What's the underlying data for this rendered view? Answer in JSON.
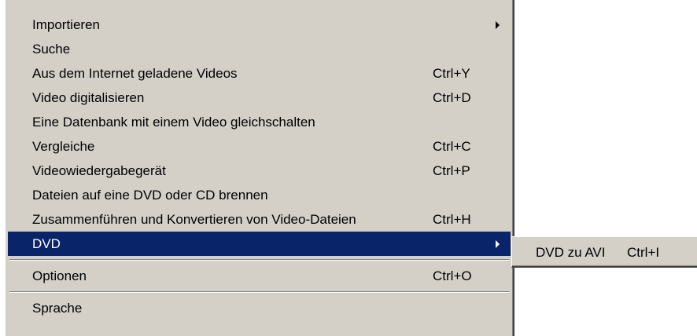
{
  "menu": {
    "items": [
      {
        "label": "Importieren",
        "shortcut": ""
      },
      {
        "label": "Suche",
        "shortcut": ""
      },
      {
        "label": "Aus dem Internet geladene Videos",
        "shortcut": "Ctrl+Y"
      },
      {
        "label": "Video digitalisieren",
        "shortcut": "Ctrl+D"
      },
      {
        "label": "Eine Datenbank mit einem Video gleichschalten",
        "shortcut": ""
      },
      {
        "label": "Vergleiche",
        "shortcut": "Ctrl+C"
      },
      {
        "label": "Videowiedergabegerät",
        "shortcut": "Ctrl+P"
      },
      {
        "label": "Dateien auf eine DVD oder CD brennen",
        "shortcut": ""
      },
      {
        "label": "Zusammenführen und Konvertieren von Video-Dateien",
        "shortcut": "Ctrl+H"
      },
      {
        "label": "DVD",
        "shortcut": ""
      },
      {
        "label": "Optionen",
        "shortcut": "Ctrl+O"
      },
      {
        "label": "Sprache",
        "shortcut": ""
      }
    ]
  },
  "submenu": {
    "items": [
      {
        "label": "DVD zu AVI",
        "shortcut": "Ctrl+I"
      }
    ]
  },
  "colors": {
    "menu_background": "#d4d0c8",
    "highlight_background": "#0a246a",
    "highlight_text": "#ffffff"
  },
  "icons": {
    "submenu_arrow": "triangle-right"
  }
}
